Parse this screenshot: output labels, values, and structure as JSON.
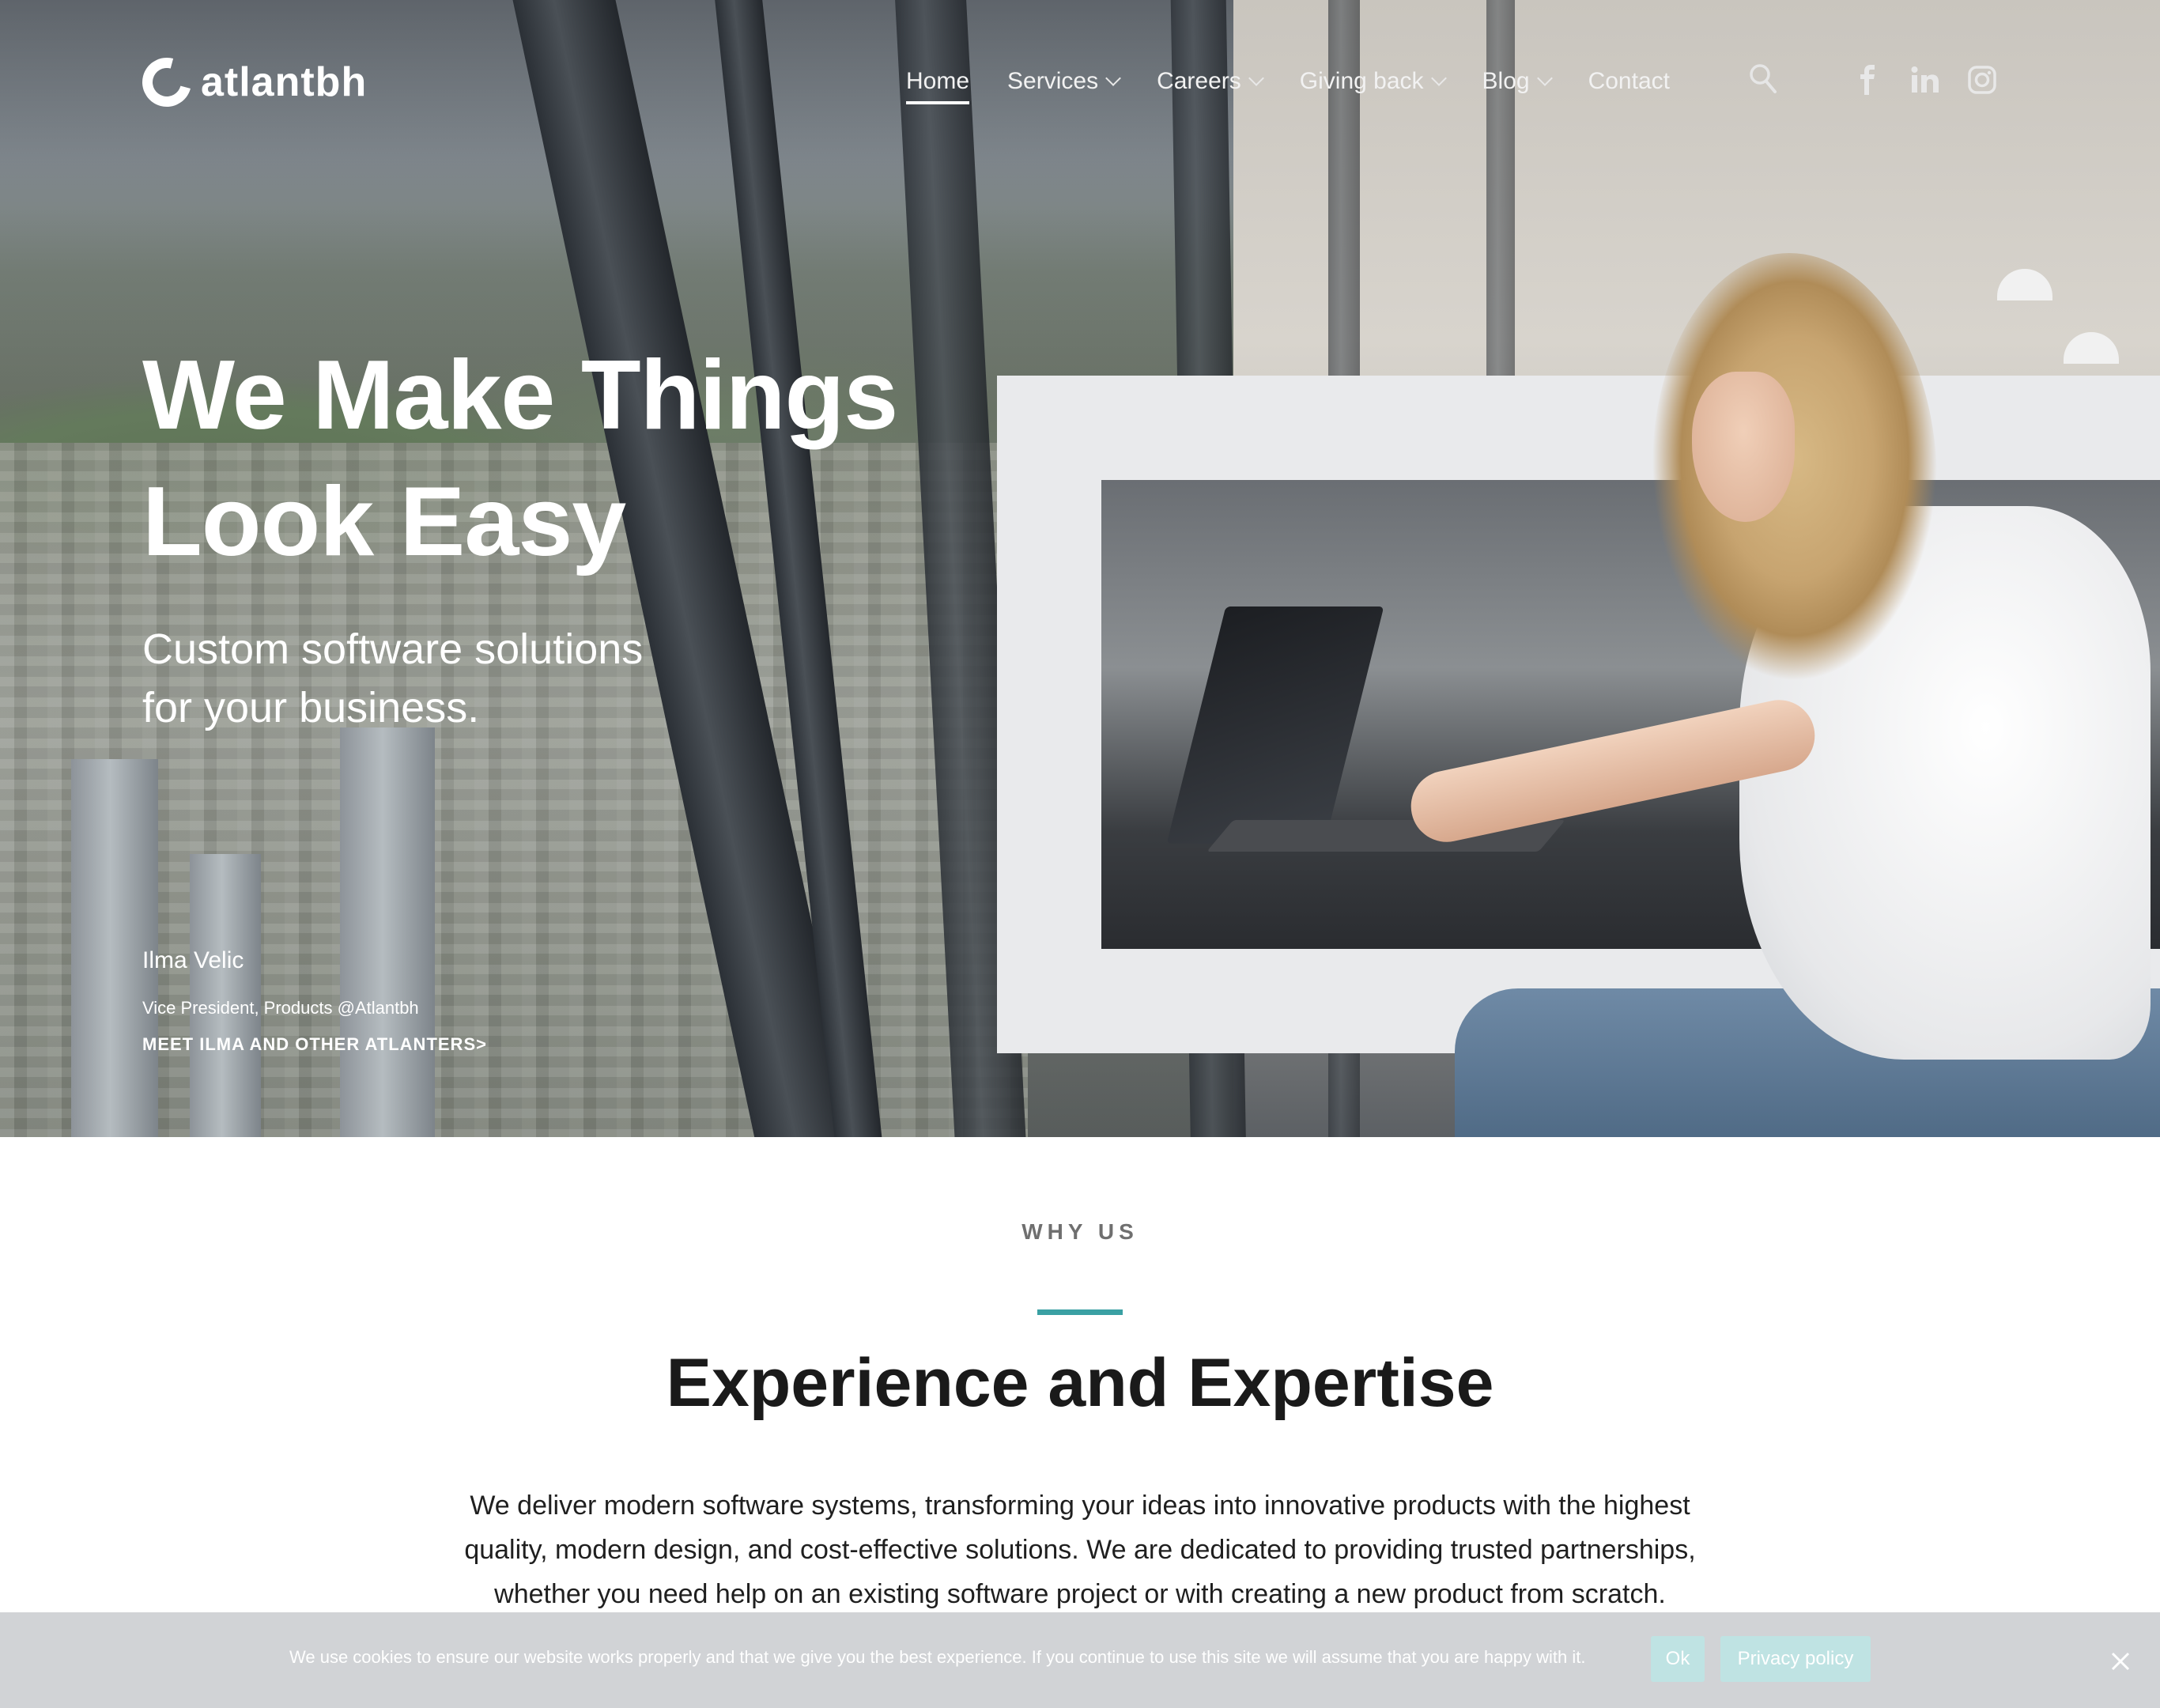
{
  "brand": {
    "name": "atlantbh"
  },
  "nav": {
    "items": [
      {
        "label": "Home",
        "active": true,
        "dropdown": false
      },
      {
        "label": "Services",
        "active": false,
        "dropdown": true
      },
      {
        "label": "Careers",
        "active": false,
        "dropdown": true
      },
      {
        "label": "Giving back",
        "active": false,
        "dropdown": true
      },
      {
        "label": "Blog",
        "active": false,
        "dropdown": true
      },
      {
        "label": "Contact",
        "active": false,
        "dropdown": false
      }
    ],
    "social": [
      "facebook-icon",
      "linkedin-icon",
      "instagram-icon"
    ]
  },
  "hero": {
    "title_line1": "We Make Things",
    "title_line2": "Look Easy",
    "subtitle_line1": "Custom software solutions",
    "subtitle_line2": "for your business.",
    "person_name": "Ilma Velic",
    "person_role": "Vice President, Products @Atlantbh",
    "cta": "MEET ILMA AND OTHER ATLANTERS>"
  },
  "why_us": {
    "eyebrow": "WHY US",
    "title": "Experience and Expertise",
    "body": "We deliver modern software systems, transforming your ideas into innovative products with the highest quality, modern design, and cost-effective solutions. We are dedicated to providing trusted partnerships, whether you need help on an existing software project or with creating a new product from scratch."
  },
  "cookie": {
    "text": "We use cookies to ensure our website works properly and that we give you the best experience. If you continue to use this site we will assume that you are happy with it.",
    "ok_label": "Ok",
    "policy_label": "Privacy policy"
  },
  "colors": {
    "accent": "#3aa0a3",
    "cookie_button": "#bfe3e3",
    "heading": "#1a1a1a"
  }
}
